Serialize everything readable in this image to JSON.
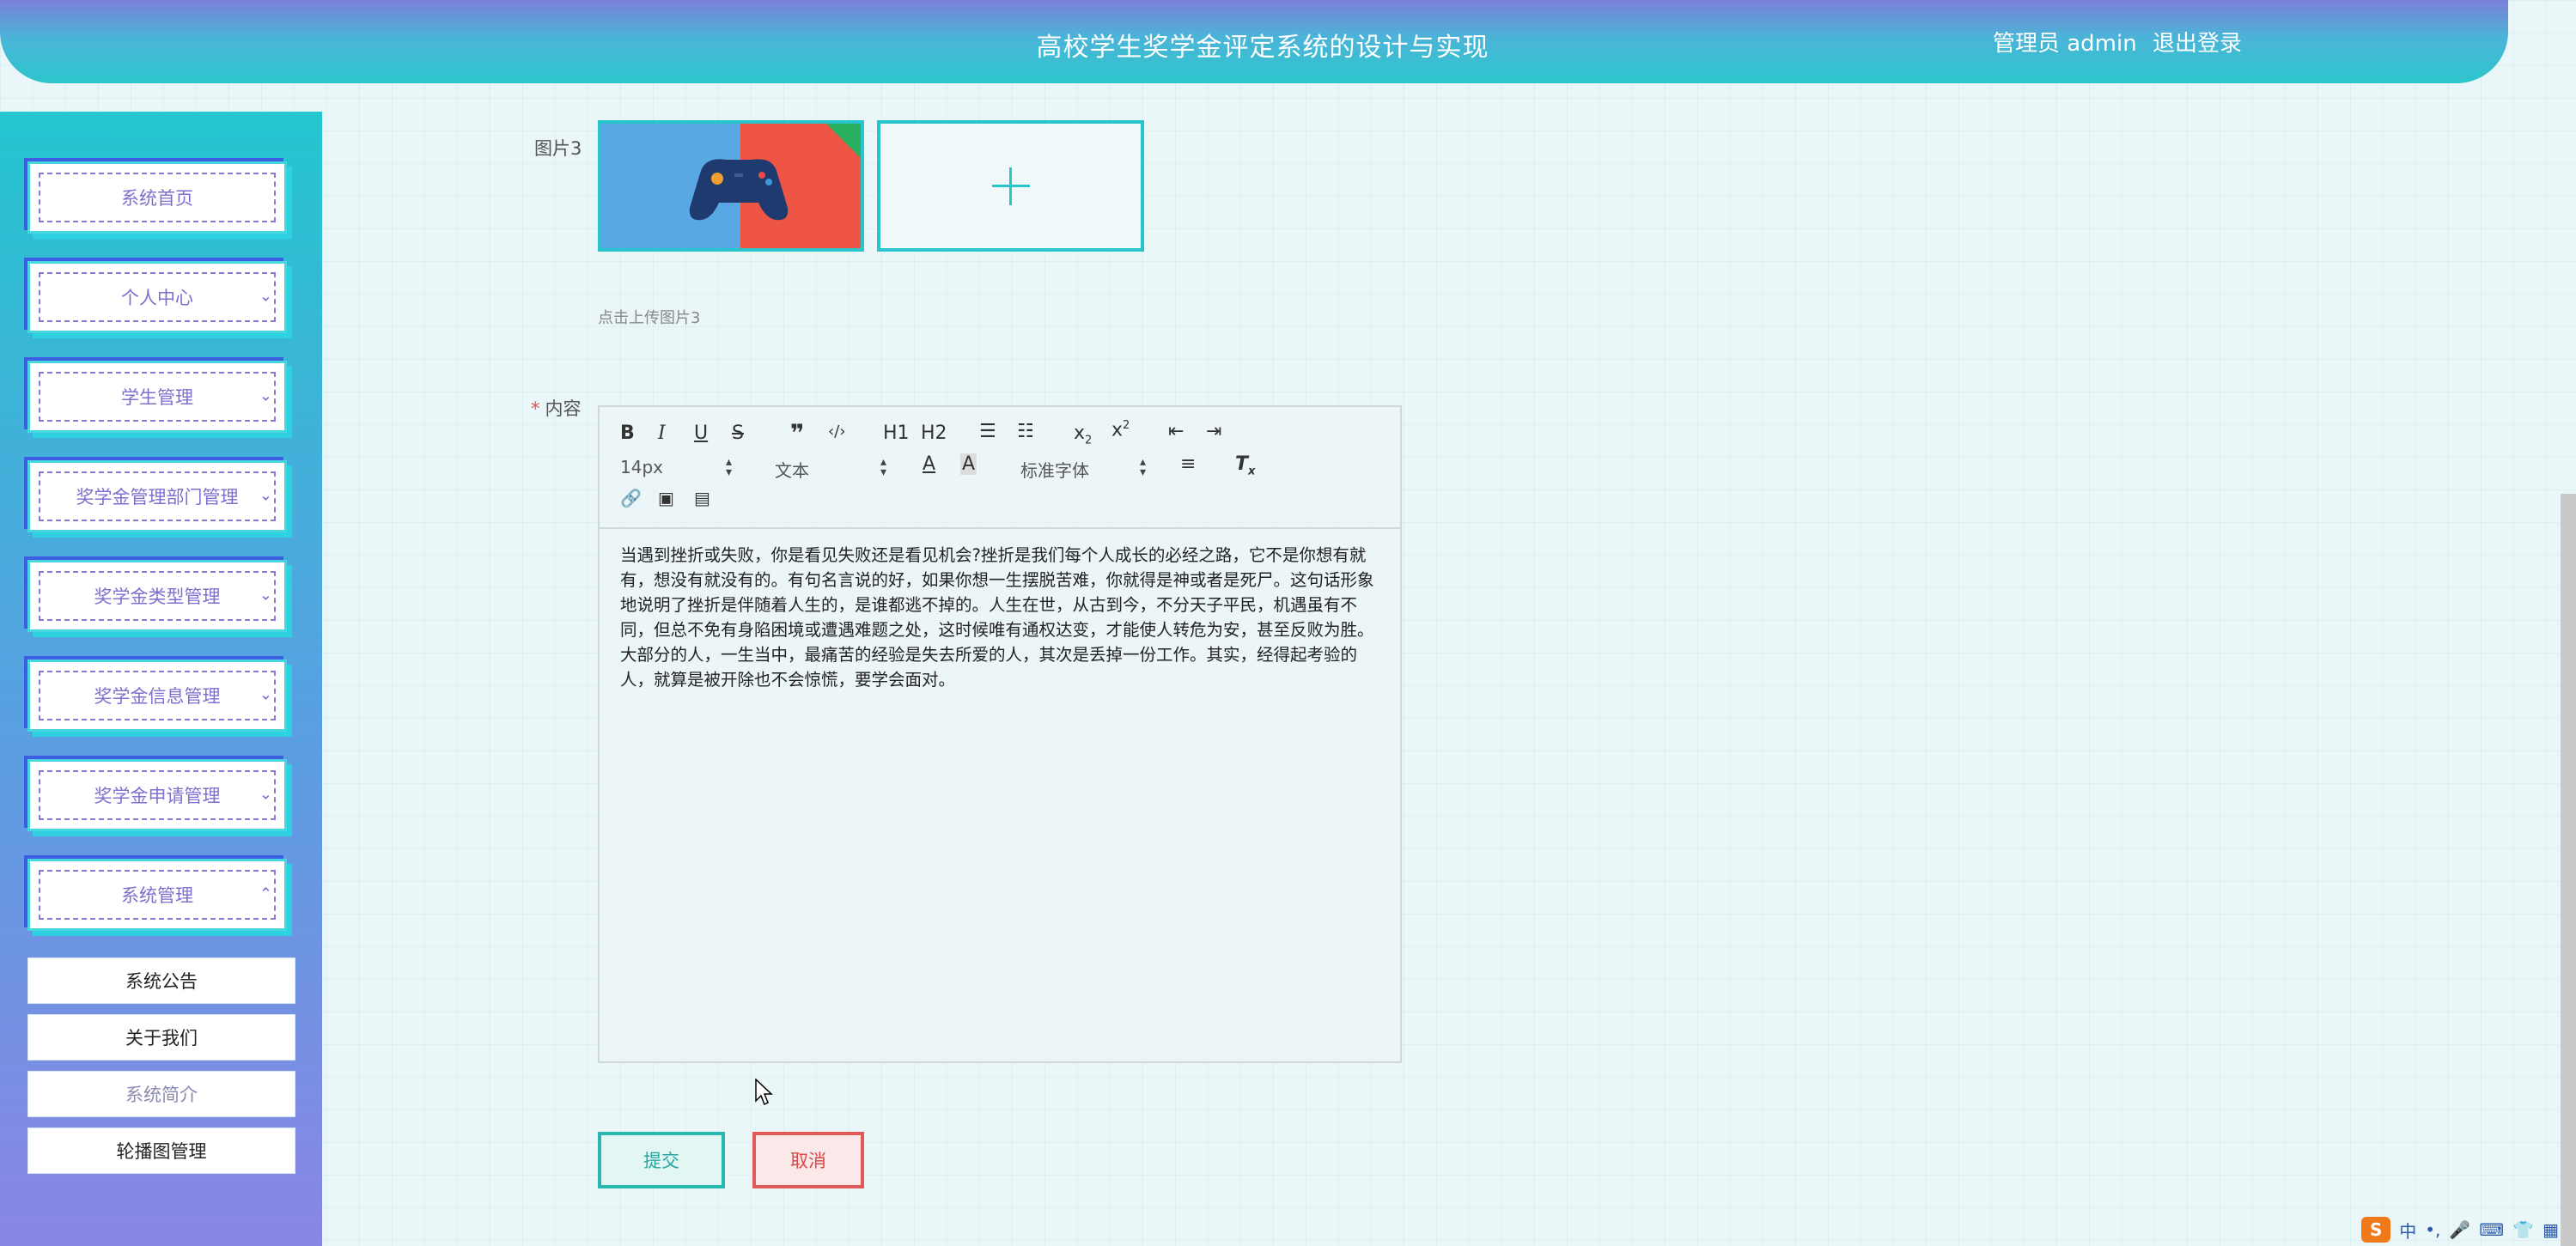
{
  "header": {
    "title": "高校学生奖学金评定系统的设计与实现",
    "user": "管理员 admin",
    "logout": "退出登录"
  },
  "sidebar": {
    "items": [
      {
        "label": "系统首页",
        "expandable": false
      },
      {
        "label": "个人中心",
        "expandable": true
      },
      {
        "label": "学生管理",
        "expandable": true
      },
      {
        "label": "奖学金管理部门管理",
        "expandable": true
      },
      {
        "label": "奖学金类型管理",
        "expandable": true
      },
      {
        "label": "奖学金信息管理",
        "expandable": true
      },
      {
        "label": "奖学金申请管理",
        "expandable": true
      },
      {
        "label": "系统管理",
        "expandable": true,
        "expanded": true
      }
    ],
    "submenu": [
      {
        "label": "系统公告"
      },
      {
        "label": "关于我们"
      },
      {
        "label": "系统简介"
      },
      {
        "label": "轮播图管理"
      }
    ]
  },
  "form": {
    "image3_label": "图片3",
    "image3_hint": "点击上传图片3",
    "content_label": "内容",
    "required_mark": "*",
    "toolbar": {
      "font_size": "14px",
      "block_type": "文本",
      "font_family": "标准字体",
      "h1": "H1",
      "h2": "H2"
    },
    "content_text": "当遇到挫折或失败，你是看见失败还是看见机会?挫折是我们每个人成长的必经之路，它不是你想有就有，想没有就没有的。有句名言说的好，如果你想一生摆脱苦难，你就得是神或者是死尸。这句话形象地说明了挫折是伴随着人生的，是谁都逃不掉的。人生在世，从古到今，不分天子平民，机遇虽有不同，但总不免有身陷困境或遭遇难题之处，这时候唯有通权达变，才能使人转危为安，甚至反败为胜。大部分的人，一生当中，最痛苦的经验是失去所爱的人，其次是丢掉一份工作。其实，经得起考验的人，就算是被开除也不会惊慌，要学会面对。",
    "submit": "提交",
    "cancel": "取消"
  },
  "ime": {
    "logo": "S",
    "mode": "中"
  },
  "colors": {
    "accent": "#28c6cc",
    "brand": "#7e6fcf",
    "danger": "#e05858"
  }
}
